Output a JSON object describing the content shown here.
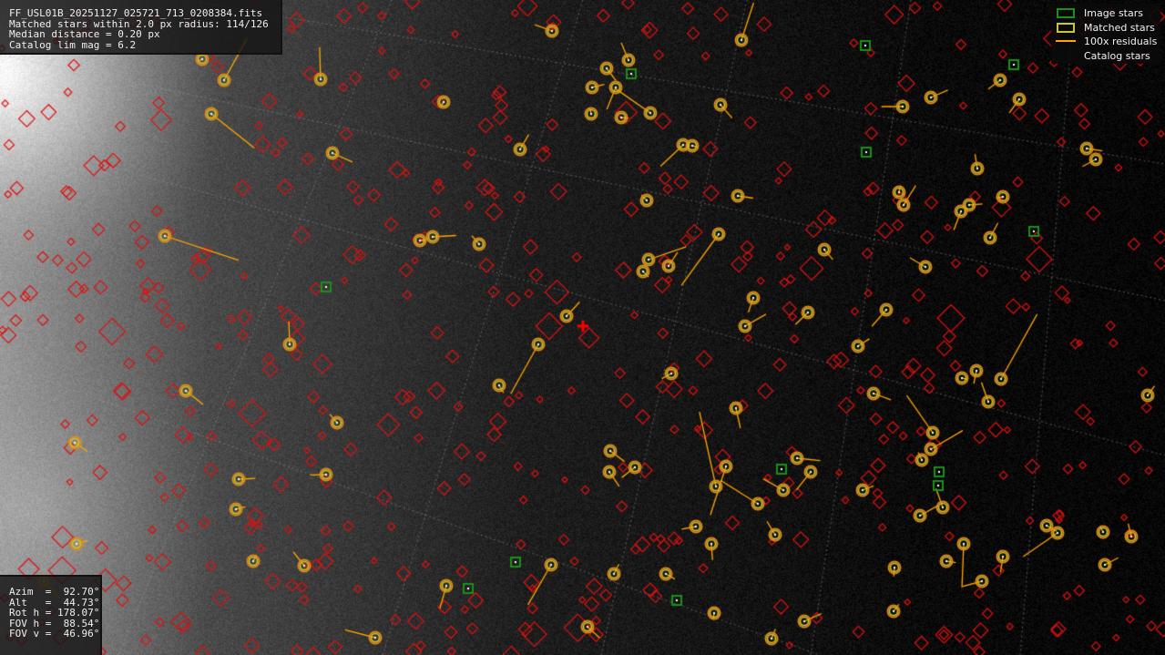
{
  "info": {
    "lines": [
      "FF_USL01B_20251127_025721_713_0208384.fits",
      "Matched stars within 2.0 px radius: 114/126",
      "Median distance = 0.20 px",
      "Catalog lim mag = 6.2"
    ]
  },
  "pointing": {
    "lines": [
      "Azim  =  92.70°",
      "Alt   =  44.73°",
      "Rot h = 178.07°",
      "FOV h =  88.54°",
      "FOV v =  46.96°"
    ]
  },
  "legend": {
    "items": [
      {
        "label": "Image stars",
        "color": "#1a8f1a",
        "symbol": "box"
      },
      {
        "label": "Matched stars",
        "color": "#c8c832",
        "symbol": "box"
      },
      {
        "label": "100x residuals",
        "color": "#ffa500",
        "symbol": "line"
      },
      {
        "label": "Catalog stars",
        "color": "#ff2020",
        "symbol": "none"
      }
    ]
  },
  "colors": {
    "catalog": "#e01010",
    "matched": "#c8c832",
    "image": "#1a8f1a",
    "residual": "#ffa500",
    "center_marker": "#ff0000",
    "grid": "#9a9a9a"
  }
}
